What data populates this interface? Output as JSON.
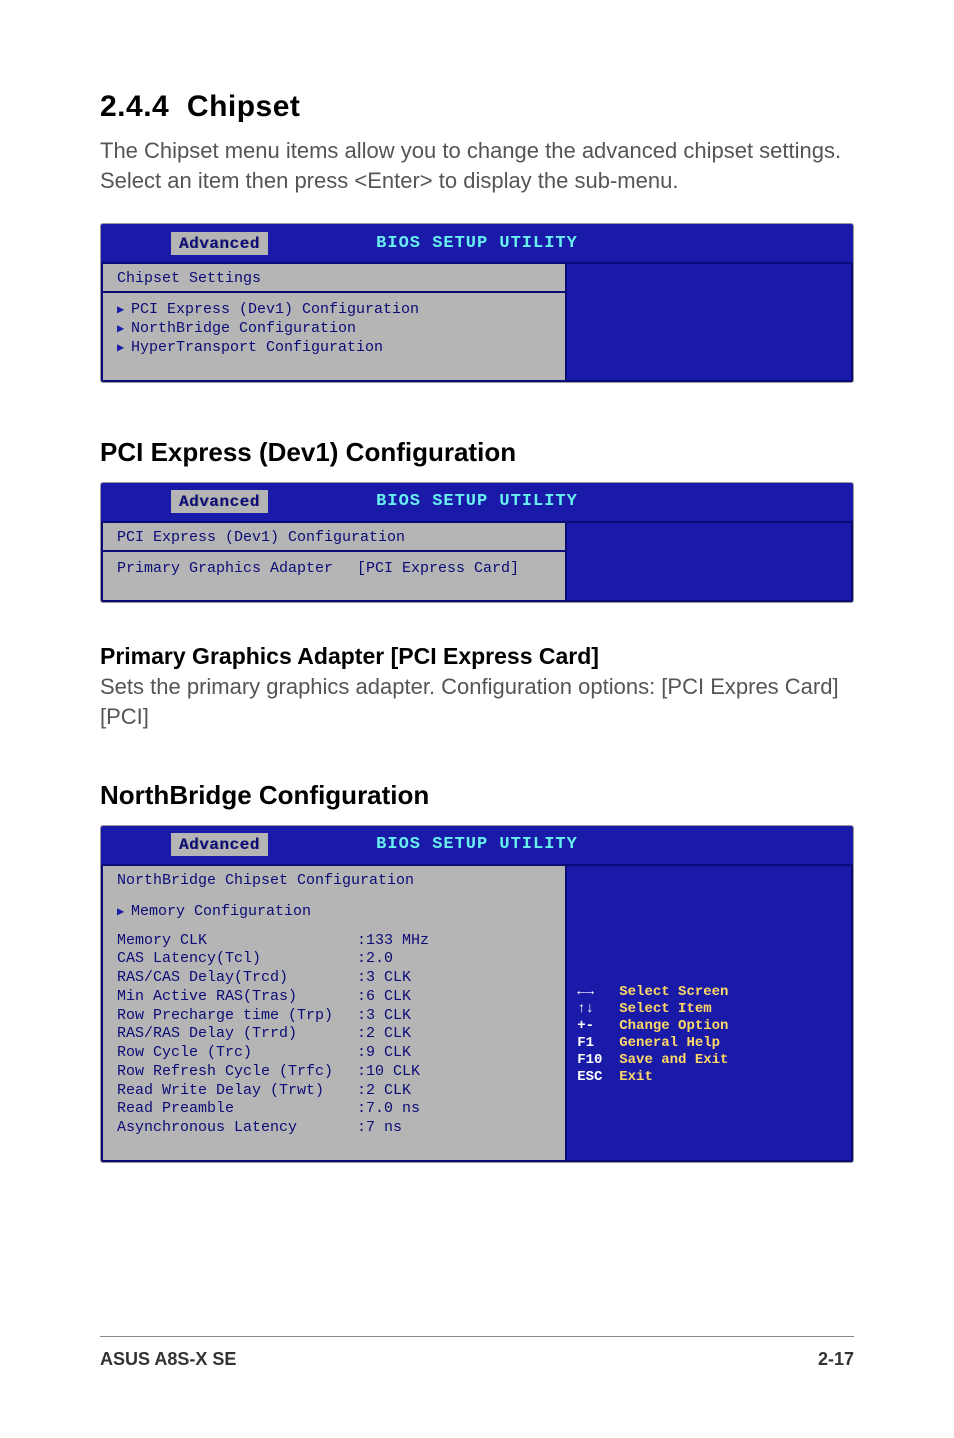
{
  "section_number": "2.4.4",
  "section_title": "Chipset",
  "intro_text": "The Chipset menu items allow you to change the advanced chipset settings. Select an item then press <Enter> to display the sub-menu.",
  "bios_common": {
    "utility_title": "BIOS SETUP UTILITY",
    "tab_label": "Advanced"
  },
  "bios1": {
    "panel_title": "Chipset Settings",
    "items": [
      "PCI Express (Dev1) Configuration",
      "NorthBridge Configuration",
      "HyperTransport Configuration"
    ]
  },
  "subhead_pci": "PCI Express (Dev1) Configuration",
  "bios2": {
    "panel_title": "PCI Express (Dev1) Configuration",
    "row_label": "Primary Graphics Adapter",
    "row_value": "[PCI Express Card]"
  },
  "option_pga": {
    "heading": "Primary Graphics Adapter [PCI Express Card]",
    "text_line1": "Sets the primary graphics adapter. Configuration options: [PCI Expres Card]",
    "text_line2": "[PCI]"
  },
  "subhead_nb": "NorthBridge Configuration",
  "bios3": {
    "panel_title": "NorthBridge Chipset Configuration",
    "submenu": "Memory Configuration",
    "rows": [
      {
        "k": "Memory CLK",
        "v": ":133 MHz"
      },
      {
        "k": "CAS Latency(Tcl)",
        "v": ":2.0"
      },
      {
        "k": "RAS/CAS Delay(Trcd)",
        "v": ":3 CLK"
      },
      {
        "k": "Min Active RAS(Tras)",
        "v": ":6 CLK"
      },
      {
        "k": "Row Precharge time (Trp)",
        "v": ":3 CLK"
      },
      {
        "k": "RAS/RAS Delay (Trrd)",
        "v": ":2 CLK"
      },
      {
        "k": "Row Cycle (Trc)",
        "v": ":9 CLK"
      },
      {
        "k": "Row Refresh Cycle (Trfc)",
        "v": ":10 CLK"
      },
      {
        "k": "Read Write Delay (Trwt)",
        "v": ":2 CLK"
      },
      {
        "k": "Read Preamble",
        "v": ":7.0 ns"
      },
      {
        "k": "Asynchronous Latency",
        "v": ":7 ns"
      }
    ],
    "help": [
      {
        "key": "←→",
        "action": "Select Screen"
      },
      {
        "key": "↑↓",
        "action": "Select Item"
      },
      {
        "key": "+-",
        "action": "Change Option"
      },
      {
        "key": "F1",
        "action": "General Help"
      },
      {
        "key": "F10",
        "action": "Save and Exit"
      },
      {
        "key": "ESC",
        "action": "Exit"
      }
    ]
  },
  "footer": {
    "left": "ASUS A8S-X SE",
    "right": "2-17"
  }
}
